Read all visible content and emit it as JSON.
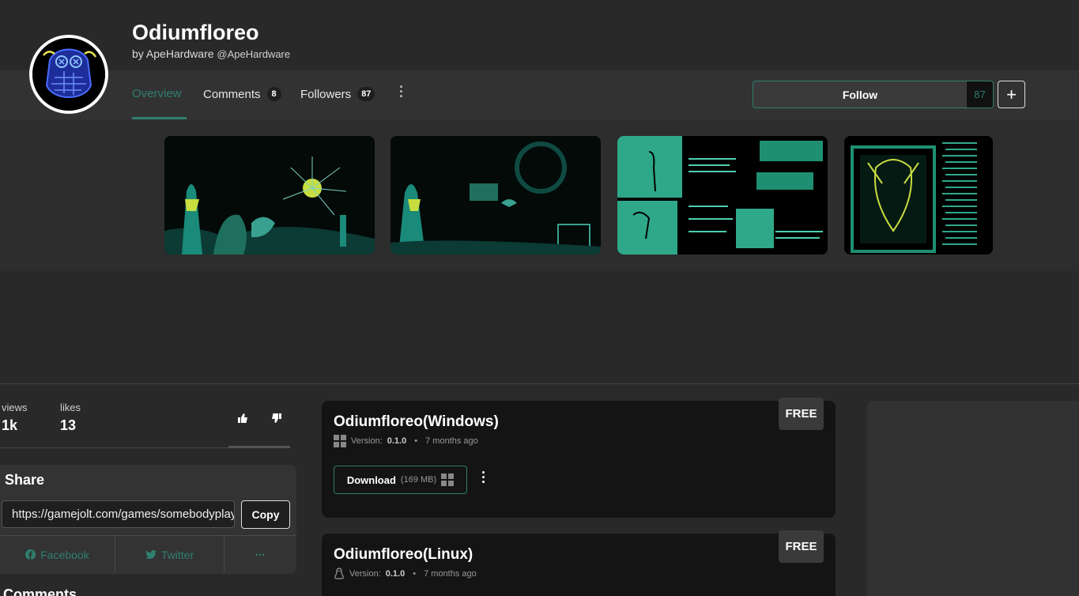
{
  "game": {
    "title": "Odiumfloreo",
    "by_prefix": "by",
    "developer": "ApeHardware",
    "handle": "@ApeHardware"
  },
  "tabs": [
    {
      "label": "Overview",
      "active": true
    },
    {
      "label": "Comments",
      "count": "8"
    },
    {
      "label": "Followers",
      "count": "87"
    }
  ],
  "follow": {
    "label": "Follow",
    "count": "87"
  },
  "stats": {
    "views_label": "views",
    "views": "1k",
    "likes_label": "likes",
    "likes": "13"
  },
  "share": {
    "title": "Share",
    "url": "https://gamejolt.com/games/somebodyplaythis",
    "copy_label": "Copy",
    "facebook": "Facebook",
    "twitter": "Twitter",
    "more": "•••"
  },
  "comments_heading": "Comments",
  "builds": [
    {
      "name": "Odiumfloreo(Windows)",
      "price": "FREE",
      "platform_icon": "windows-icon",
      "version_label": "Version:",
      "version": "0.1.0",
      "age": "7 months ago",
      "download_label": "Download",
      "size": "(169 MB)"
    },
    {
      "name": "Odiumfloreo(Linux)",
      "price": "FREE",
      "platform_icon": "linux-icon",
      "version_label": "Version:",
      "version": "0.1.0",
      "age": "7 months ago"
    }
  ],
  "colors": {
    "accent": "#2f7f6f",
    "background": "#292929",
    "card": "#141414"
  }
}
